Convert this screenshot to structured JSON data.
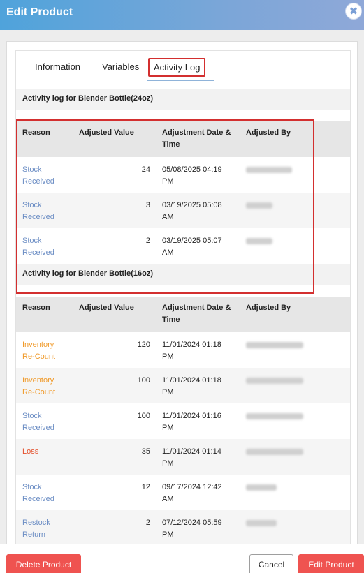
{
  "modal": {
    "title": "Edit Product",
    "close_icon": "close-icon"
  },
  "tabs": [
    {
      "label": "Information"
    },
    {
      "label": "Variables"
    },
    {
      "label": "Activity Log",
      "active": true
    }
  ],
  "columns": {
    "reason": "Reason",
    "value": "Adjusted Value",
    "date_line1": "Adjustment Date &",
    "date_line2": "Time",
    "by": "Adjusted By"
  },
  "logs": [
    {
      "title": "Activity log for Blender Bottle(24oz)",
      "rows": [
        {
          "reason1": "Stock",
          "reason2": "Received",
          "type": "stock",
          "value": "24",
          "date1": "05/08/2025 04:19",
          "date2": "PM"
        },
        {
          "reason1": "Stock",
          "reason2": "Received",
          "type": "stock",
          "value": "3",
          "date1": "03/19/2025 05:08",
          "date2": "AM"
        },
        {
          "reason1": "Stock",
          "reason2": "Received",
          "type": "stock",
          "value": "2",
          "date1": "03/19/2025 05:07",
          "date2": "AM"
        }
      ]
    },
    {
      "title": "Activity log for Blender Bottle(16oz)",
      "rows": [
        {
          "reason1": "Inventory",
          "reason2": "Re-Count",
          "type": "inventory",
          "value": "120",
          "date1": "11/01/2024 01:18",
          "date2": "PM"
        },
        {
          "reason1": "Inventory",
          "reason2": "Re-Count",
          "type": "inventory",
          "value": "100",
          "date1": "11/01/2024 01:18",
          "date2": "PM"
        },
        {
          "reason1": "Stock",
          "reason2": "Received",
          "type": "stock",
          "value": "100",
          "date1": "11/01/2024 01:16",
          "date2": "PM"
        },
        {
          "reason1": "Loss",
          "reason2": "",
          "type": "loss",
          "value": "35",
          "date1": "11/01/2024 01:14",
          "date2": "PM"
        },
        {
          "reason1": "Stock",
          "reason2": "Received",
          "type": "stock",
          "value": "12",
          "date1": "09/17/2024 12:42",
          "date2": "AM"
        },
        {
          "reason1": "Restock",
          "reason2": "Return",
          "type": "stock",
          "value": "2",
          "date1": "07/12/2024 05:59",
          "date2": "PM"
        }
      ]
    }
  ],
  "colors": {
    "stock": "#6b8dc4",
    "inventory": "#f09a2a",
    "loss": "#e4522e",
    "button": "#ef5350",
    "highlight": "#d32f2f"
  },
  "footer": {
    "delete_label": "Delete Product",
    "cancel_label": "Cancel",
    "edit_label": "Edit Product"
  }
}
